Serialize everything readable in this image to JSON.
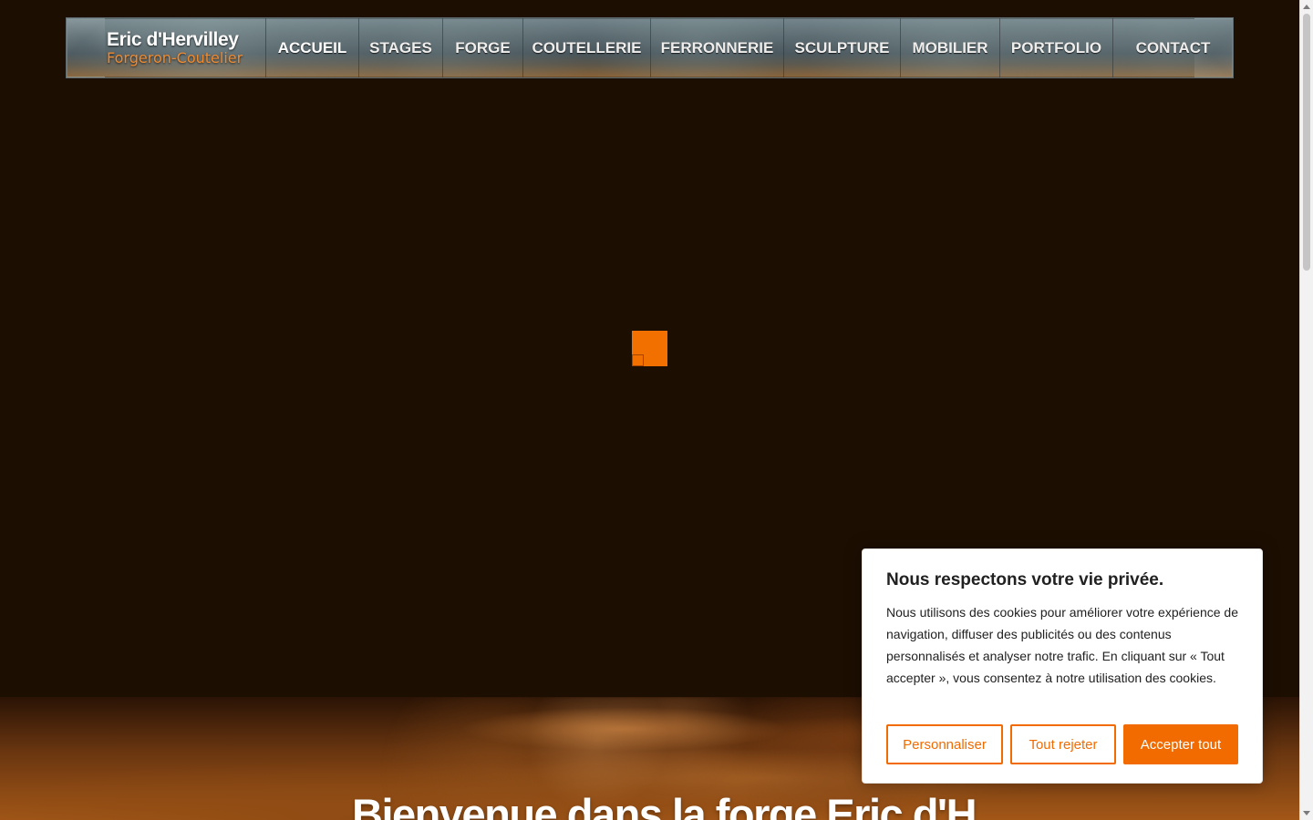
{
  "brand": {
    "name": "Eric d'Hervilley",
    "subtitle": "Forgeron-Coutelier"
  },
  "nav": {
    "items": [
      {
        "label": "ACCUEIL",
        "active": true
      },
      {
        "label": "STAGES",
        "active": false
      },
      {
        "label": "FORGE",
        "active": false
      },
      {
        "label": "COUTELLERIE",
        "active": false
      },
      {
        "label": "FERRONNERIE",
        "active": false
      },
      {
        "label": "SCULPTURE",
        "active": false
      },
      {
        "label": "MOBILIER",
        "active": false
      },
      {
        "label": "PORTFOLIO",
        "active": false
      },
      {
        "label": "CONTACT",
        "active": false
      }
    ]
  },
  "hero": {
    "title": "Bienvenue dans la forge Eric d'H"
  },
  "cookie_banner": {
    "title": "Nous respectons votre vie privée.",
    "text": "Nous utilisons des cookies pour améliorer votre expérience de navigation, diffuser des publicités ou des contenus personnalisés et analyser notre trafic. En cliquant sur « Tout accepter », vous consentez à notre utilisation des cookies.",
    "buttons": {
      "customize": "Personnaliser",
      "reject": "Tout rejeter",
      "accept": "Accepter tout"
    }
  },
  "colors": {
    "background": "#1d0e02",
    "accent": "#f26b00",
    "brand_subtitle": "#f08a2f",
    "nav_text": "#efeeec",
    "cookie_background": "#ffffff",
    "cookie_text": "#212121"
  },
  "icons": {
    "loader": "orange-square-loader-icon",
    "scroll_up": "scroll-up-arrow-icon",
    "scroll_down": "scroll-down-arrow-icon"
  }
}
